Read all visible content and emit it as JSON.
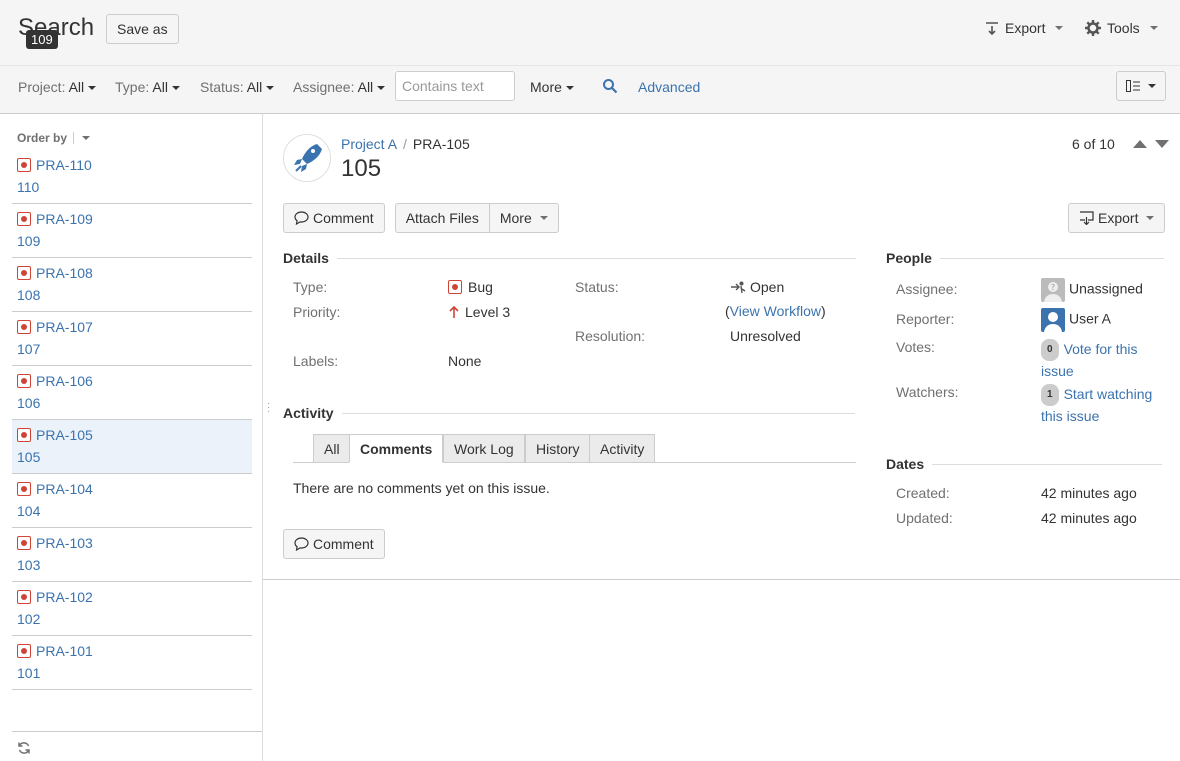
{
  "header": {
    "title": "Search",
    "badge": "109",
    "save_as": "Save as",
    "export": "Export",
    "tools": "Tools"
  },
  "filters": {
    "project": {
      "label": "Project:",
      "value": "All"
    },
    "type": {
      "label": "Type:",
      "value": "All"
    },
    "status": {
      "label": "Status:",
      "value": "All"
    },
    "assignee": {
      "label": "Assignee:",
      "value": "All"
    },
    "text_placeholder": "Contains text",
    "more": "More",
    "advanced": "Advanced"
  },
  "list": {
    "order_by": "Order by",
    "items": [
      {
        "key": "PRA-110",
        "summary": "110"
      },
      {
        "key": "PRA-109",
        "summary": "109"
      },
      {
        "key": "PRA-108",
        "summary": "108"
      },
      {
        "key": "PRA-107",
        "summary": "107"
      },
      {
        "key": "PRA-106",
        "summary": "106"
      },
      {
        "key": "PRA-105",
        "summary": "105",
        "selected": true
      },
      {
        "key": "PRA-104",
        "summary": "104"
      },
      {
        "key": "PRA-103",
        "summary": "103"
      },
      {
        "key": "PRA-102",
        "summary": "102"
      },
      {
        "key": "PRA-101",
        "summary": "101"
      }
    ]
  },
  "issue": {
    "project": "Project A",
    "key": "PRA-105",
    "title": "105",
    "pager": "6 of 10",
    "ops": {
      "comment": "Comment",
      "attach": "Attach Files",
      "more": "More",
      "export": "Export"
    },
    "details": {
      "heading": "Details",
      "type_label": "Type:",
      "type_value": "Bug",
      "priority_label": "Priority:",
      "priority_value": "Level 3",
      "labels_label": "Labels:",
      "labels_value": "None",
      "status_label": "Status:",
      "status_value": "Open",
      "workflow_open": "(",
      "workflow_link": "View Workflow",
      "workflow_close": ")",
      "resolution_label": "Resolution:",
      "resolution_value": "Unresolved"
    },
    "activity": {
      "heading": "Activity",
      "tabs": [
        "All",
        "Comments",
        "Work Log",
        "History",
        "Activity"
      ],
      "active_tab": "Comments",
      "empty": "There are no comments yet on this issue.",
      "comment_button": "Comment"
    },
    "people": {
      "heading": "People",
      "assignee_label": "Assignee:",
      "assignee_value": "Unassigned",
      "reporter_label": "Reporter:",
      "reporter_value": "User A",
      "votes_label": "Votes:",
      "votes_count": "0",
      "votes_link_1": "Vote for this",
      "votes_link_2": "issue",
      "watchers_label": "Watchers:",
      "watchers_count": "1",
      "watchers_link_1": "Start watching",
      "watchers_link_2": "this issue"
    },
    "dates": {
      "heading": "Dates",
      "created_label": "Created:",
      "created_value": "42 minutes ago",
      "updated_label": "Updated:",
      "updated_value": "42 minutes ago"
    }
  },
  "colors": {
    "link": "#3b73af",
    "bug": "#d04437",
    "selected_row": "#ebf2f9"
  }
}
